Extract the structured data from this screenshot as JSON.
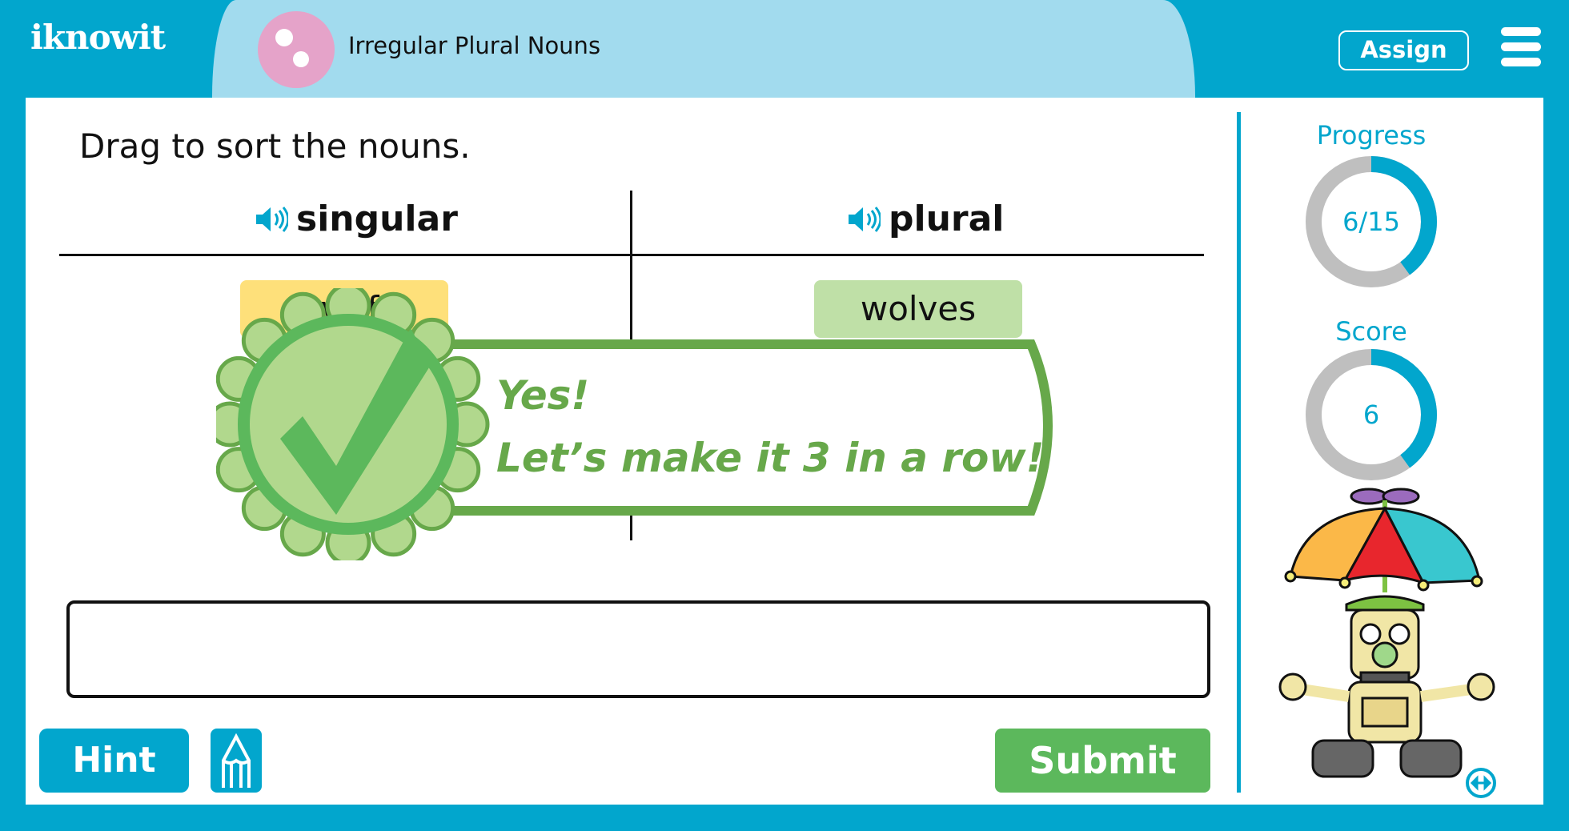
{
  "header": {
    "logo": "iknowit",
    "lesson_title": "Irregular Plural Nouns",
    "assign_label": "Assign",
    "menu_icon": "hamburger-icon"
  },
  "activity": {
    "instruction": "Drag to sort the nouns.",
    "columns": [
      {
        "label": "singular",
        "icon": "speaker-icon",
        "items": [
          "wolf"
        ]
      },
      {
        "label": "plural",
        "icon": "speaker-icon",
        "items": [
          "wolves"
        ]
      }
    ],
    "answer_box": ""
  },
  "feedback": {
    "line1": "Yes!",
    "line2": "Let’s make it 3 in a row!",
    "icon": "checkmark-badge-icon"
  },
  "buttons": {
    "hint": "Hint",
    "submit": "Submit",
    "pencil_icon": "pencil-icon"
  },
  "sidebar": {
    "progress_label": "Progress",
    "progress_value": "6/15",
    "progress_fraction": 0.4,
    "score_label": "Score",
    "score_value": "6",
    "score_fraction": 0.4,
    "mascot": "robot-with-umbrella",
    "swap_icon": "swap-arrows-icon"
  },
  "colors": {
    "brand": "#02a6cd",
    "submit": "#5cb85c",
    "singular_chip": "#fee07a",
    "plural_chip": "#bfe0a7",
    "feedback": "#67a84a"
  }
}
